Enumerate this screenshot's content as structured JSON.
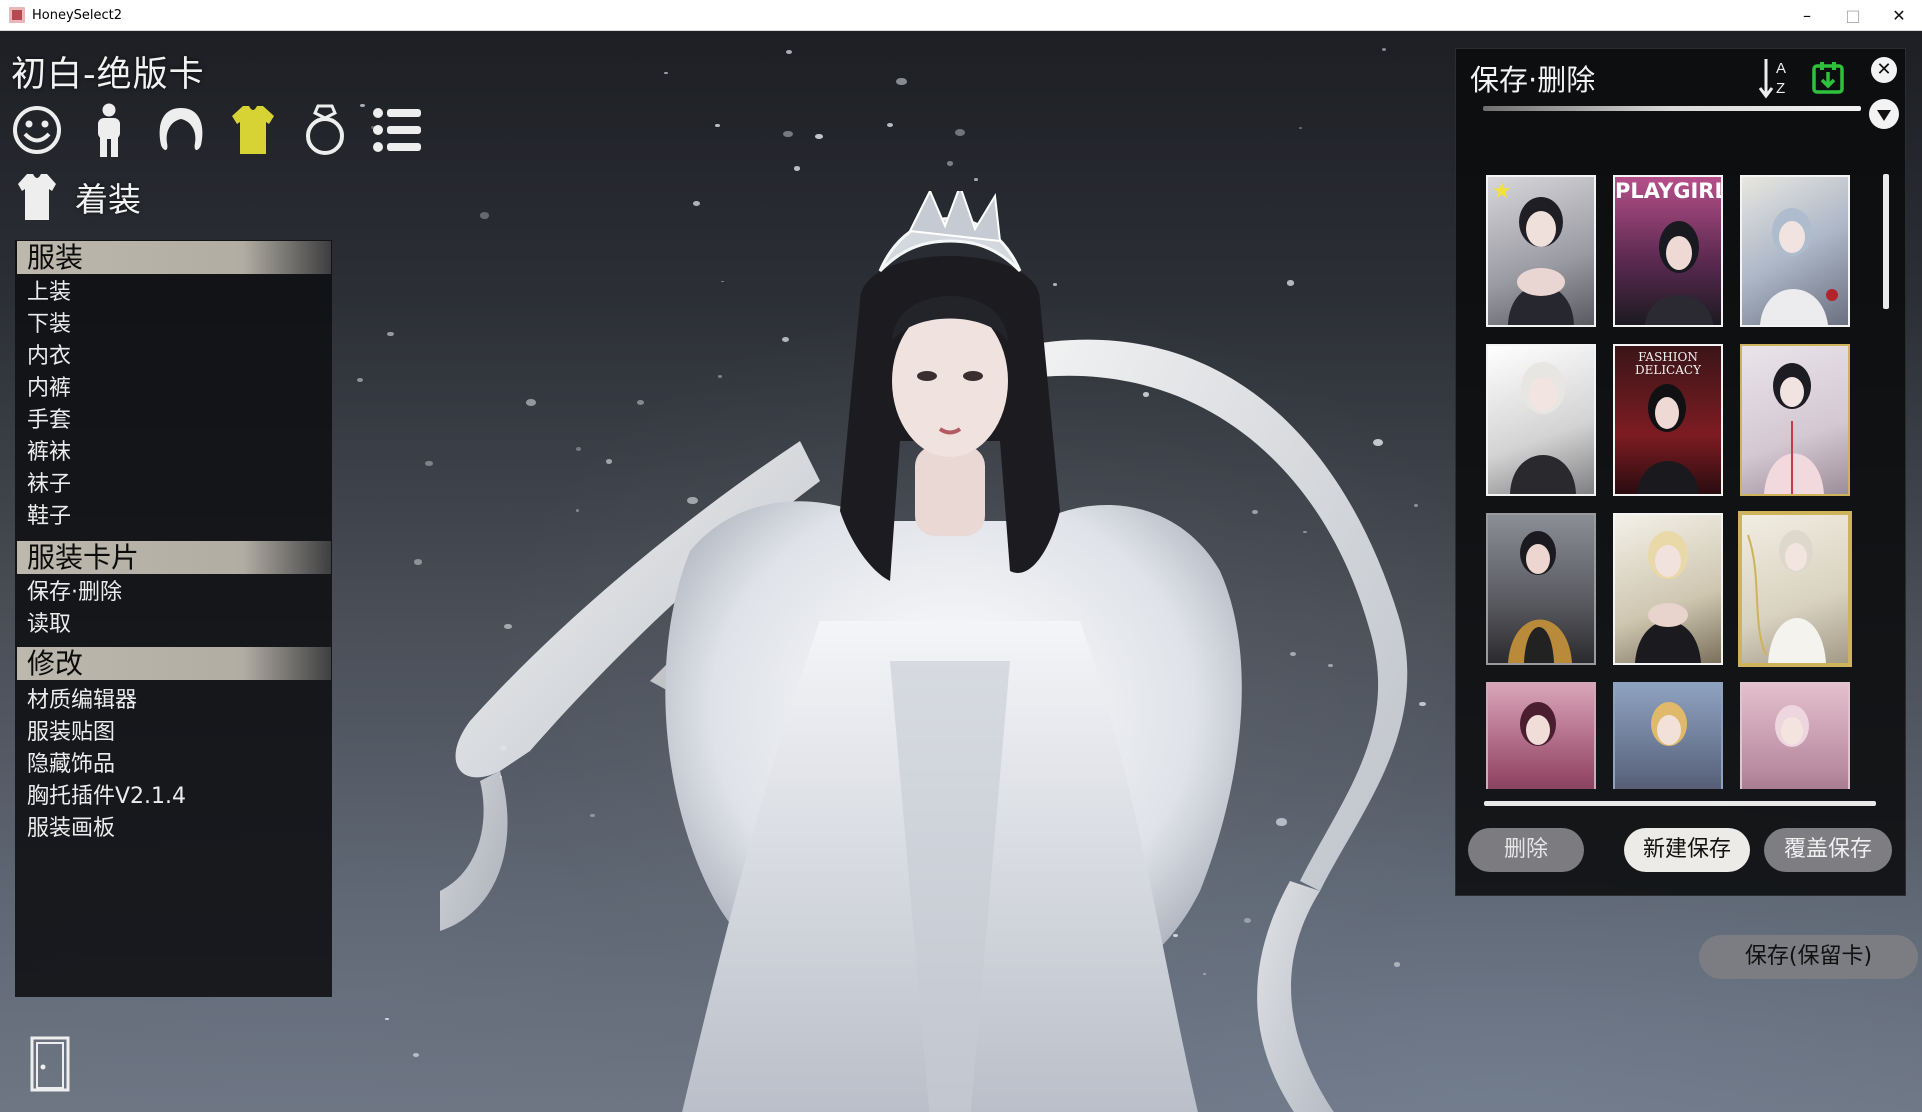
{
  "window": {
    "title": "HoneySelect2"
  },
  "window_controls": {
    "minimize": "–",
    "maximize": "□",
    "close": "✕"
  },
  "character": {
    "name": "初白-绝版卡"
  },
  "category_icons": [
    {
      "name": "face-icon"
    },
    {
      "name": "body-icon"
    },
    {
      "name": "hair-icon"
    },
    {
      "name": "clothing-icon",
      "active": true
    },
    {
      "name": "accessory-ring-icon"
    },
    {
      "name": "list-menu-icon"
    }
  ],
  "section": {
    "title": "着装",
    "icon": "shirt-icon"
  },
  "menu": {
    "groups": [
      {
        "title": "服装",
        "items": [
          "上装",
          "下装",
          "内衣",
          "内裤",
          "手套",
          "裤袜",
          "袜子",
          "鞋子"
        ]
      },
      {
        "title": "服装卡片",
        "items": [
          "保存·删除",
          "读取"
        ]
      },
      {
        "title": "修改",
        "items": [
          "材质编辑器",
          "服装贴图",
          "隐藏饰品",
          "胸托插件V2.1.4",
          "服装画板"
        ]
      }
    ]
  },
  "save_panel": {
    "title": "保存·删除",
    "sort_icon": "sort-az-icon",
    "save_icon": "download-save-icon",
    "close_label": "✕",
    "cards": [
      {
        "name": "card-1",
        "favorite": "★"
      },
      {
        "name": "card-2",
        "caption": "PLAYGIRL"
      },
      {
        "name": "card-3"
      },
      {
        "name": "card-4"
      },
      {
        "name": "card-5",
        "caption": "FASHION DELICACY"
      },
      {
        "name": "card-6"
      },
      {
        "name": "card-7"
      },
      {
        "name": "card-8"
      },
      {
        "name": "card-9"
      },
      {
        "name": "card-10"
      },
      {
        "name": "card-11"
      },
      {
        "name": "card-12"
      }
    ],
    "buttons": {
      "delete": "删除",
      "new_save": "新建保存",
      "overwrite": "覆盖保存"
    }
  },
  "keep_card_button": "保存(保留卡)",
  "colors": {
    "accent": "#d7d335",
    "gold_frame": "#cfb35a",
    "green_save": "#2ec23c"
  }
}
